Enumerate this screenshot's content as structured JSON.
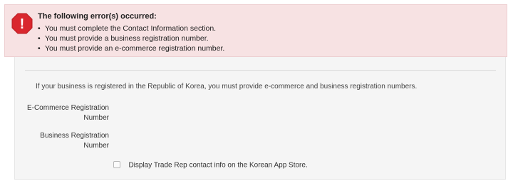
{
  "error_banner": {
    "icon": "error-octagon-icon",
    "icon_glyph": "!",
    "title": "The following error(s) occurred:",
    "bullet": "•",
    "errors": [
      "You must complete the Contact Information section.",
      "You must provide a business registration number.",
      "You must provide an e-commerce registration number."
    ],
    "colors": {
      "background": "#f7e2e3",
      "icon": "#d9272e"
    }
  },
  "form": {
    "intro": "If your business is registered in the Republic of Korea, you must provide e-commerce and business registration numbers.",
    "ecommerce_label_line1": "E-Commerce Registration",
    "ecommerce_label_line2": "Number",
    "ecommerce_value": "",
    "business_label_line1": "Business Registration",
    "business_label_line2": "Number",
    "business_value": "",
    "checkbox_checked": false,
    "checkbox_label": "Display Trade Rep contact info on the Korean App Store."
  }
}
